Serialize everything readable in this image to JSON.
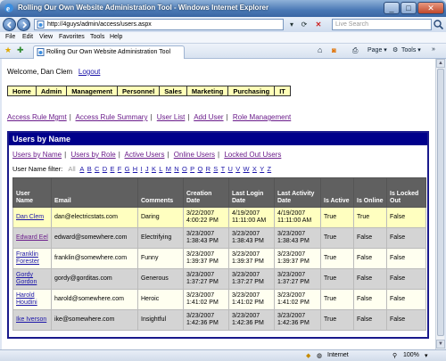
{
  "window": {
    "title": "Rolling Our Own Website Administration Tool - Windows Internet Explorer",
    "controls": {
      "minimize": "_",
      "maximize": "□",
      "close": "✕"
    }
  },
  "address_bar": {
    "url": "http://4guys/admin/access/users.aspx",
    "search_placeholder": "Live Search"
  },
  "menu": [
    "File",
    "Edit",
    "View",
    "Favorites",
    "Tools",
    "Help"
  ],
  "tab": {
    "label": "Rolling Our Own Website Administration Tool"
  },
  "toolbar": {
    "page_label": "Page",
    "tools_label": "Tools"
  },
  "status": {
    "zone": "Internet",
    "zoom": "100%"
  },
  "page": {
    "welcome": "Welcome, Dan Clem",
    "logout": "Logout",
    "main_menu": [
      "Home",
      "Admin",
      "Management",
      "Personnel",
      "Sales",
      "Marketing",
      "Purchasing",
      "IT"
    ],
    "sub_links": [
      "Access Rule Mgmt",
      "Access Rule Summary",
      "User List",
      "Add User",
      "Role Management"
    ],
    "panel_title": "Users by Name",
    "filters": [
      "Users by Name",
      "Users by Role",
      "Active Users",
      "Online Users",
      "Locked Out Users"
    ],
    "filter_label": "User Name filter:",
    "filter_all": "All",
    "letters": [
      "A",
      "B",
      "C",
      "D",
      "E",
      "F",
      "G",
      "H",
      "I",
      "J",
      "K",
      "L",
      "M",
      "N",
      "O",
      "P",
      "Q",
      "R",
      "S",
      "T",
      "U",
      "V",
      "W",
      "X",
      "Y",
      "Z"
    ],
    "columns": [
      "User Name",
      "Email",
      "Comments",
      "Creation Date",
      "Last Login Date",
      "Last Activity Date",
      "Is Active",
      "Is Online",
      "Is Locked Out"
    ],
    "rows": [
      {
        "user": "Dan Clem",
        "email": "dan@electricstats.com",
        "comments": "Daring",
        "created": "3/22/2007 4:00:22 PM",
        "last_login": "4/19/2007 11:11:00 AM",
        "last_activity": "4/19/2007 11:11:00 AM",
        "active": "True",
        "online": "True",
        "locked": "False"
      },
      {
        "user": "Edward Eel",
        "email": "edward@somewhere.com",
        "comments": "Electrifying",
        "created": "3/23/2007 1:38:43 PM",
        "last_login": "3/23/2007 1:38:43 PM",
        "last_activity": "3/23/2007 1:38:43 PM",
        "active": "True",
        "online": "False",
        "locked": "False"
      },
      {
        "user": "Franklin Forester",
        "email": "franklin@somewhere.com",
        "comments": "Funny",
        "created": "3/23/2007 1:39:37 PM",
        "last_login": "3/23/2007 1:39:37 PM",
        "last_activity": "3/23/2007 1:39:37 PM",
        "active": "True",
        "online": "False",
        "locked": "False"
      },
      {
        "user": "Gordy Gordon",
        "email": "gordy@gorditas.com",
        "comments": "Generous",
        "created": "3/23/2007 1:37:27 PM",
        "last_login": "3/23/2007 1:37:27 PM",
        "last_activity": "3/23/2007 1:37:27 PM",
        "active": "True",
        "online": "False",
        "locked": "False"
      },
      {
        "user": "Harold Houdini",
        "email": "harold@somewhere.com",
        "comments": "Heroic",
        "created": "3/23/2007 1:41:02 PM",
        "last_login": "3/23/2007 1:41:02 PM",
        "last_activity": "3/23/2007 1:41:02 PM",
        "active": "True",
        "online": "False",
        "locked": "False"
      },
      {
        "user": "Ike Iverson",
        "email": "ike@somewhere.com",
        "comments": "Insightful",
        "created": "3/23/2007 1:42:36 PM",
        "last_login": "3/23/2007 1:42:36 PM",
        "last_activity": "3/23/2007 1:42:36 PM",
        "active": "True",
        "online": "False",
        "locked": "False"
      }
    ]
  },
  "colors": {
    "panel_header": "#00008b",
    "menu_bg": "#ffffb8",
    "link": "#1a14a8",
    "visited_link": "#6a1b8a"
  }
}
